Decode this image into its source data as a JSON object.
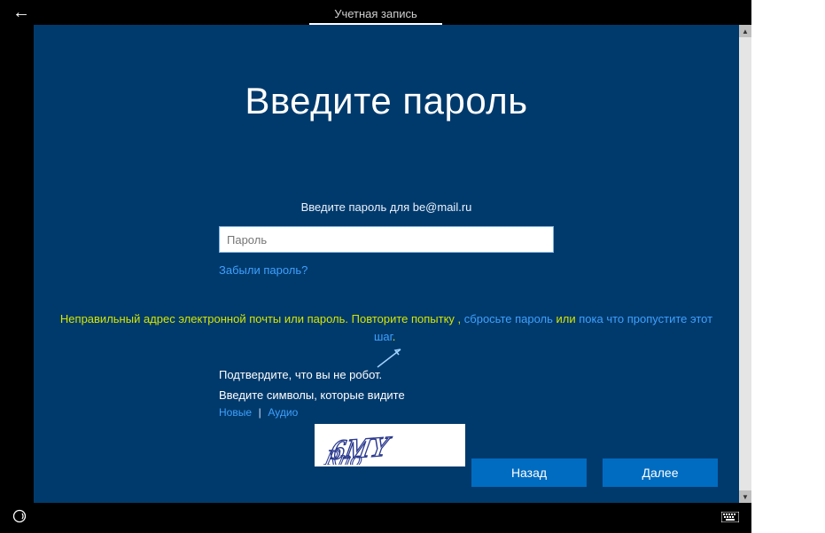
{
  "header": {
    "tab_label": "Учетная запись"
  },
  "main": {
    "title": "Введите пароль",
    "prompt": "Введите пароль для be@mail.ru",
    "password_placeholder": "Пароль",
    "password_value": "",
    "forgot_label": "Забыли пароль?"
  },
  "error": {
    "prefix": "Неправильный адрес электронной почты или пароль. Повторите попытку",
    "sep1": " , ",
    "reset_link": "сбросьте пароль",
    "sep2": " или ",
    "skip_link": "пока что пропустите этот шаг",
    "suffix": "."
  },
  "captcha": {
    "confirm_label": "Подтвердите, что вы не робот.",
    "enter_label": "Введите символы, которые видите",
    "new_link": "Новые",
    "audio_link": "Аудио",
    "image_text": "6MY"
  },
  "buttons": {
    "back": "Назад",
    "next": "Далее"
  }
}
